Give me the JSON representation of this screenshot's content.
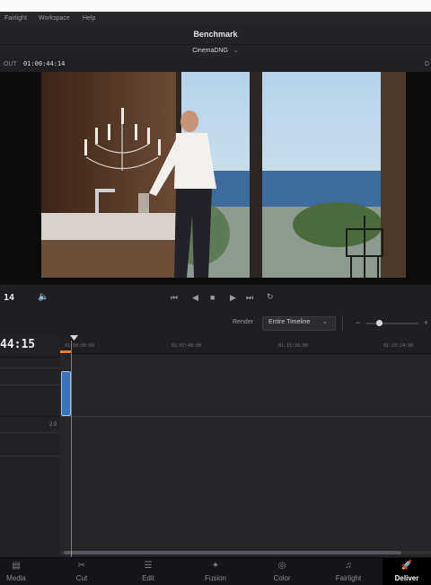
{
  "menu": [
    "Fairlight",
    "Workspace",
    "Help"
  ],
  "window_title": "Benchmark",
  "preset": {
    "label": "CinemaDNG",
    "chevron": "⌄"
  },
  "viewer": {
    "out_label": "OUT",
    "out_timecode": "01:00:44:14",
    "right_edge_text": "D"
  },
  "transport": {
    "timecode_fragment": "14",
    "volume_icon": "speaker-icon",
    "buttons": [
      "⏮",
      "◀",
      "■",
      "▶",
      "⏭",
      "↻"
    ]
  },
  "render_bar": {
    "render_label": "Render",
    "render_value": "Entire Timeline",
    "minus": "−",
    "plus": "+"
  },
  "timeline": {
    "timecode": "44:15",
    "ruler_labels": [
      "01:00:00:00",
      "01:07:48:00",
      "01:15:36:00",
      "01:23:24:00"
    ],
    "audio_level": "2.0"
  },
  "pages": [
    {
      "label": "Media",
      "icon": "media-icon",
      "glyph": "▤"
    },
    {
      "label": "Cut",
      "icon": "cut-icon",
      "glyph": "✂"
    },
    {
      "label": "Edit",
      "icon": "edit-icon",
      "glyph": "☰"
    },
    {
      "label": "Fusion",
      "icon": "fusion-icon",
      "glyph": "✦"
    },
    {
      "label": "Color",
      "icon": "color-icon",
      "glyph": "◎"
    },
    {
      "label": "Fairlight",
      "icon": "fairlight-icon",
      "glyph": "♫"
    },
    {
      "label": "Deliver",
      "icon": "deliver-icon",
      "glyph": "🚀"
    }
  ],
  "colors": {
    "accent": "#f47b20",
    "clip": "#3b73b9",
    "active_tab": "#000000"
  }
}
